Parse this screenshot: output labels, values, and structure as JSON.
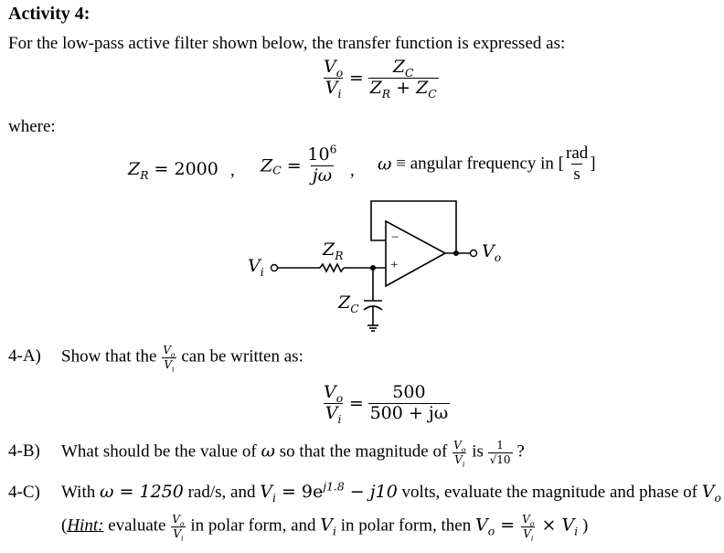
{
  "heading": "Activity 4:",
  "intro": "For the low-pass active filter shown below, the transfer function is expressed as:",
  "transfer_function": {
    "lhs_num": "V",
    "lhs_num_sub": "o",
    "lhs_den": "V",
    "lhs_den_sub": "i",
    "rhs_num": "Z",
    "rhs_num_sub": "C",
    "rhs_den_a": "Z",
    "rhs_den_a_sub": "R",
    "rhs_den_plus": " + ",
    "rhs_den_b": "Z",
    "rhs_den_b_sub": "C"
  },
  "where_label": "where:",
  "definitions": {
    "zr_label": "Z",
    "zr_sub": "R",
    "zr_value": " = 2000",
    "sep": ",",
    "zc_label": "Z",
    "zc_sub": "C",
    "zc_eq": " =",
    "zc_num": "10",
    "zc_num_sup": "6",
    "zc_den": "jω",
    "omega_symbol": "ω",
    "omega_text": " ≡ angular frequency in [",
    "unit_num": "rad",
    "unit_den": "s",
    "unit_close": "]"
  },
  "circuit": {
    "vi_label": "V",
    "vi_sub": "i",
    "vo_label": "V",
    "vo_sub": "o",
    "zr_label": "Z",
    "zr_sub": "R",
    "zc_label": "Z",
    "zc_sub": "C",
    "minus_sign": "−",
    "plus_sign": "+"
  },
  "parts": {
    "a": {
      "label": "4-A)",
      "text_before": "Show that the ",
      "text_after": " can be written as:",
      "result_num": "500",
      "result_den": "500 + jω"
    },
    "b": {
      "label": "4-B)",
      "text_before": "What should be the value of ",
      "omega": "ω",
      "text_mid": " so that the magnitude of ",
      "text_is": " is ",
      "target_num": "1",
      "target_den": "√10",
      "text_end": " ?"
    },
    "c": {
      "label": "4-C)",
      "text_with": "With ",
      "omega_eq": "ω = 1250",
      "units": " rad/s, and ",
      "vi": "V",
      "vi_sub": "i",
      "vi_expr": " = 9e",
      "vi_exp": "j1.8",
      "vi_rest": " − j10",
      "text_end": "  volts, evaluate the magnitude and phase of ",
      "vo": "V",
      "vo_sub": "o"
    },
    "hint": {
      "open": "(",
      "hint_word": "Hint:",
      "t1": " evaluate ",
      "t2": " in polar form, and ",
      "vi": "V",
      "vi_sub": "i",
      "t3": " in polar form, then ",
      "vo": "V",
      "vo_sub": "o",
      "eq": " = ",
      "times": " × ",
      "close": " )"
    }
  }
}
